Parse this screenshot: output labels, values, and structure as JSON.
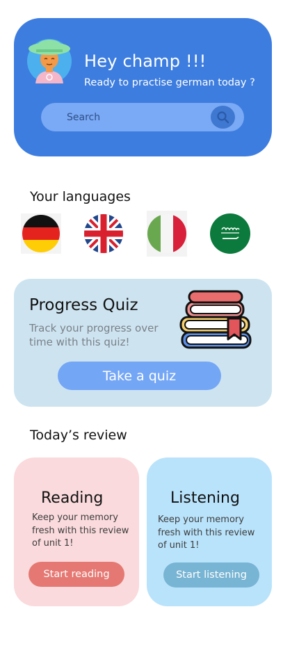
{
  "header": {
    "greeting": "Hey champ !!!",
    "subtitle": "Ready to practise german today ?",
    "search_placeholder": "Search",
    "avatar_icon": "user-avatar-icon",
    "search_icon": "search-icon"
  },
  "languages": {
    "title": "Your languages",
    "flags": [
      "germany-flag-icon",
      "uk-flag-icon",
      "italy-flag-icon",
      "saudi-arabia-flag-icon"
    ]
  },
  "quiz": {
    "title": "Progress Quiz",
    "description": "Track your progress over time with this quiz!",
    "button_label": "Take a quiz",
    "illustration": "books-icon"
  },
  "review": {
    "title": "Today’s review",
    "cards": [
      {
        "title": "Reading",
        "description": "Keep your memory fresh with this review of unit 1!",
        "button_label": "Start reading",
        "button_color": "#e57872"
      },
      {
        "title": "Listening",
        "description": "Keep your memory fresh with this review of unit 1!",
        "button_label": "Start listening",
        "button_color": "#78b4d3"
      }
    ]
  },
  "colors": {
    "primary": "#3d7ddf",
    "quiz_bg": "#cde4f0",
    "reading_bg": "#fadadc",
    "listening_bg": "#b9e3fb"
  }
}
